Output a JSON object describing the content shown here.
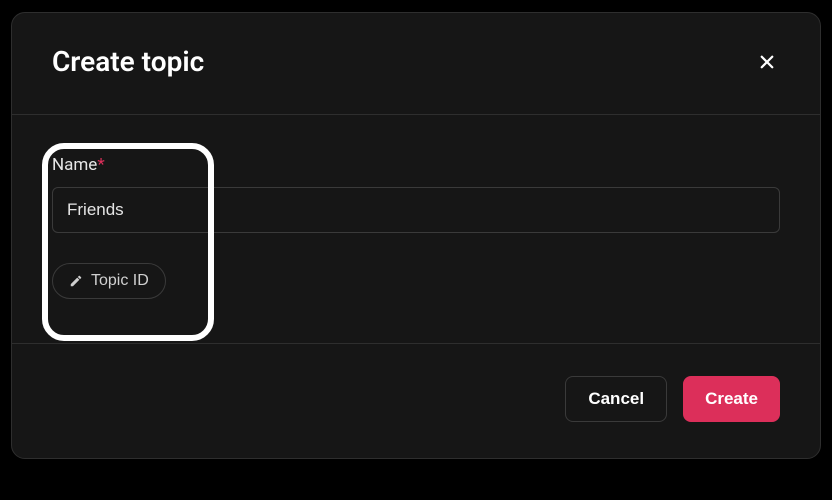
{
  "dialog": {
    "title": "Create topic",
    "name_label": "Name",
    "name_value": "Friends",
    "topic_id_label": "Topic ID",
    "cancel_label": "Cancel",
    "create_label": "Create"
  }
}
